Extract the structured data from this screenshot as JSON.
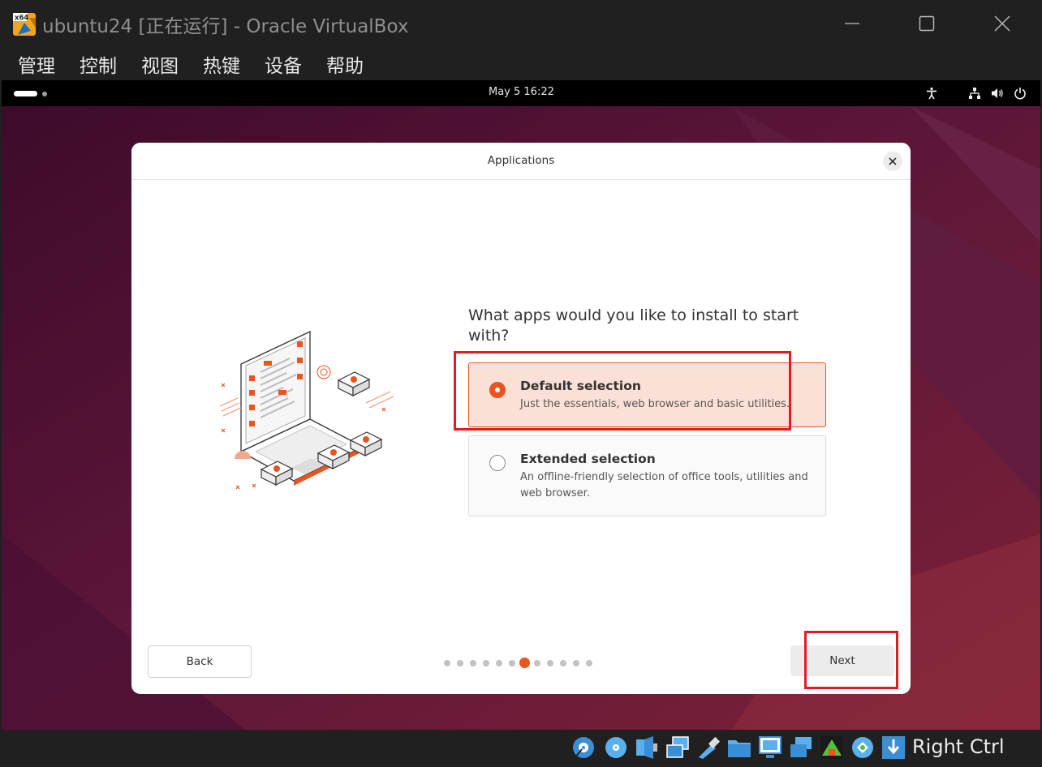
{
  "window": {
    "title": "ubuntu24 [正在运行] - Oracle VirtualBox",
    "app_icon": "virtualbox-x64-icon"
  },
  "menu": {
    "items": [
      {
        "label": "管理"
      },
      {
        "label": "控制"
      },
      {
        "label": "视图"
      },
      {
        "label": "热键"
      },
      {
        "label": "设备"
      },
      {
        "label": "帮助"
      }
    ]
  },
  "topbar": {
    "clock": "May 5  16:22",
    "tray_icons": [
      "accessibility-icon",
      "network-icon",
      "volume-icon",
      "power-icon"
    ]
  },
  "dialog": {
    "title": "Applications",
    "question": "What apps would you like to install to start with?",
    "options": [
      {
        "title": "Default selection",
        "description": "Just the essentials, web browser and basic utilities.",
        "selected": true
      },
      {
        "title": "Extended selection",
        "description": "An offline-friendly selection of office tools, utilities and web browser.",
        "selected": false
      }
    ],
    "back_label": "Back",
    "next_label": "Next",
    "steps_total": 12,
    "steps_current": 7
  },
  "statusbar": {
    "icons": [
      "hard-disk-icon",
      "optical-disk-icon",
      "audio-icon",
      "network-adapter-icon",
      "usb-icon",
      "shared-folder-icon",
      "display-icon",
      "video-capture-icon",
      "guest-additions-icon",
      "drag-drop-icon",
      "keyboard-capture-icon"
    ],
    "host_key": "Right Ctrl"
  },
  "colors": {
    "accent": "#e9541f",
    "annotation": "#e01b24",
    "selected_bg": "#fbe0d7"
  }
}
